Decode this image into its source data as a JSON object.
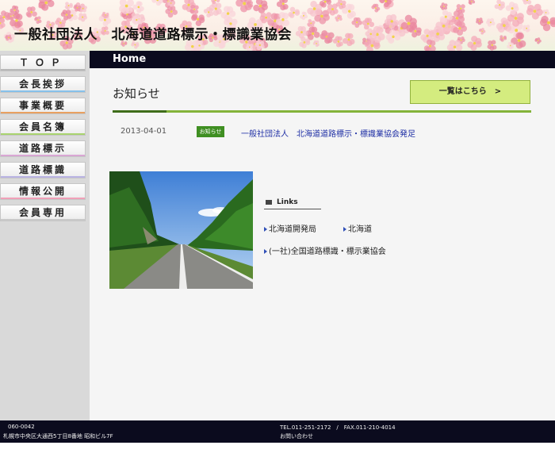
{
  "header": {
    "title": "一般社団法人　北海道道路標示・標識業協会"
  },
  "sidebar": {
    "items": [
      {
        "label": "ＴＯＰ",
        "bar_color": "#b7b7b7"
      },
      {
        "label": "会長挨拶",
        "bar_color": "#86c1ea"
      },
      {
        "label": "事業概要",
        "bar_color": "#e8a060"
      },
      {
        "label": "会員名簿",
        "bar_color": "#a9d36f"
      },
      {
        "label": "道路標示",
        "bar_color": "#d9a6d4"
      },
      {
        "label": "道路標識",
        "bar_color": "#b9b3e3"
      },
      {
        "label": "情報公開",
        "bar_color": "#f0a0b8"
      },
      {
        "label": "会員専用",
        "bar_color": "#c9c9c9"
      }
    ]
  },
  "main": {
    "section_title": "Home",
    "news": {
      "heading": "お知らせ",
      "more_button": "一覧はこちら　>",
      "items": [
        {
          "date": "2013-04-01",
          "badge": "お知らせ",
          "text": "一般社団法人　北海道道路標示・標識業協会発足"
        }
      ]
    },
    "links": {
      "heading": "Links",
      "items": [
        "北海道開発局",
        "北海道",
        "(一社)全国道路標識・標示業協会"
      ]
    }
  },
  "footer": {
    "postal": "060-0042",
    "address": "札幌市中央区大通西5丁目8番地 昭和ビル7F",
    "phone": "TEL.011-251-2172　/　FAX.011-210-4014",
    "contact": "お問い合わせ"
  },
  "colors": {
    "accent_green": "#84b33a",
    "header_bar": "#0b0b1e",
    "button_green": "#d4ec7f"
  }
}
